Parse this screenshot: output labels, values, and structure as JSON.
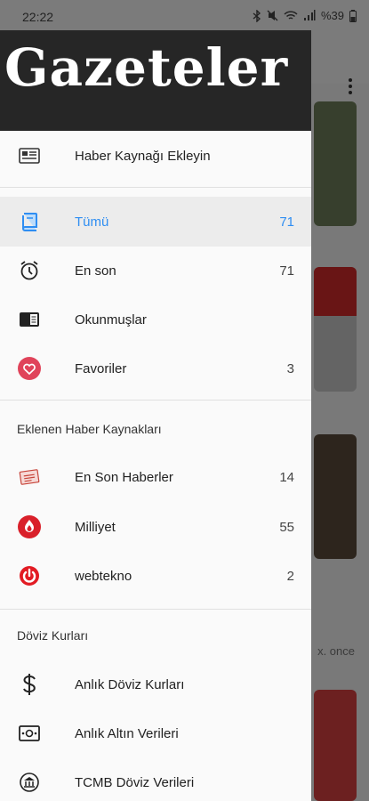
{
  "status_bar": {
    "time": "22:22",
    "battery": "%39"
  },
  "drawer": {
    "title": "Gazeteler",
    "add_source": {
      "label": "Haber Kaynağı Ekleyin",
      "icon": "newspaper-icon"
    },
    "filters": [
      {
        "label": "Tümü",
        "count": "71",
        "icon": "book-icon",
        "active": true
      },
      {
        "label": "En son",
        "count": "71",
        "icon": "alarm-clock-icon"
      },
      {
        "label": "Okunmuşlar",
        "count": "",
        "icon": "read-book-icon"
      },
      {
        "label": "Favoriler",
        "count": "3",
        "icon": "heart-icon"
      }
    ],
    "sources_section": {
      "title": "Eklenen Haber Kaynakları",
      "items": [
        {
          "label": "En Son Haberler",
          "count": "14",
          "icon": "en-son-haberler-logo"
        },
        {
          "label": "Milliyet",
          "count": "55",
          "icon": "milliyet-logo"
        },
        {
          "label": "webtekno",
          "count": "2",
          "icon": "webtekno-logo"
        }
      ]
    },
    "currency_section": {
      "title": "Döviz Kurları",
      "items": [
        {
          "label": "Anlık Döviz Kurları",
          "icon": "dollar-icon"
        },
        {
          "label": "Anlık Altın Verileri",
          "icon": "banknote-icon"
        },
        {
          "label": "TCMB Döviz Verileri",
          "icon": "bank-icon"
        }
      ]
    }
  },
  "background": {
    "snippet": "x. once"
  },
  "colors": {
    "accent": "#2f8ef2",
    "header": "#262626",
    "favorite": "#e0435a",
    "milliyet": "#d9202a"
  }
}
